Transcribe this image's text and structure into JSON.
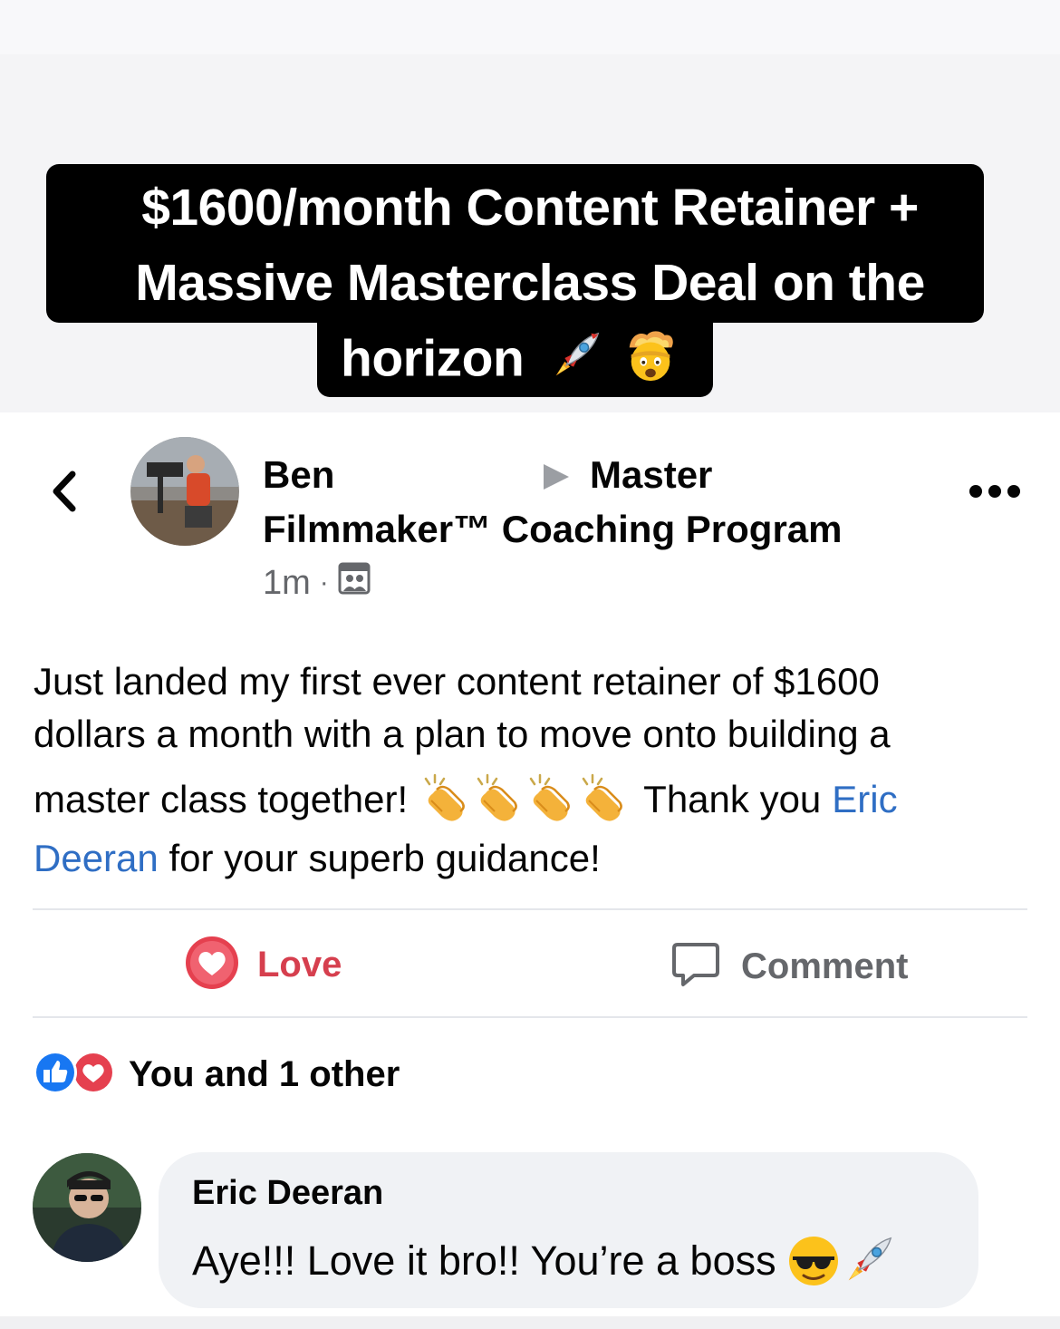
{
  "caption": {
    "line1": "$1600/month Content Retainer +",
    "line2": "Massive Masterclass Deal on the",
    "line3": "horizon",
    "emojis": [
      "rocket-icon",
      "exploding-head-icon"
    ]
  },
  "post": {
    "author": "Ben",
    "group_line1": "Master",
    "group_line2": "Filmmaker™ Coaching Program",
    "timestamp": "1m",
    "meta_separator": "·",
    "privacy_icon": "group-icon",
    "text_line1": "Just landed my first ever content retainer of $1600",
    "text_line2": "dollars a month with a plan to move onto building a",
    "text_line3_start": "master class together!",
    "text_line3_end": "Thank you",
    "mention_part1": "Eric",
    "mention_part2": "Deeran",
    "text_line4_end": "for your superb guidance!",
    "clap_emoji_count": 4
  },
  "actions": {
    "love_label": "Love",
    "comment_label": "Comment"
  },
  "reactions": {
    "summary": "You and 1 other",
    "icons": [
      "like-icon",
      "love-icon"
    ]
  },
  "comment": {
    "author": "Eric Deeran",
    "text": "Aye!!! Love it bro!! You’re a boss",
    "emojis": [
      "sunglasses-face-icon",
      "rocket-icon"
    ]
  },
  "colors": {
    "caption_bg": "#000000",
    "mention": "#2f6ec4",
    "love": "#d63f4e",
    "like": "#1877f2",
    "muted": "#65676b"
  }
}
